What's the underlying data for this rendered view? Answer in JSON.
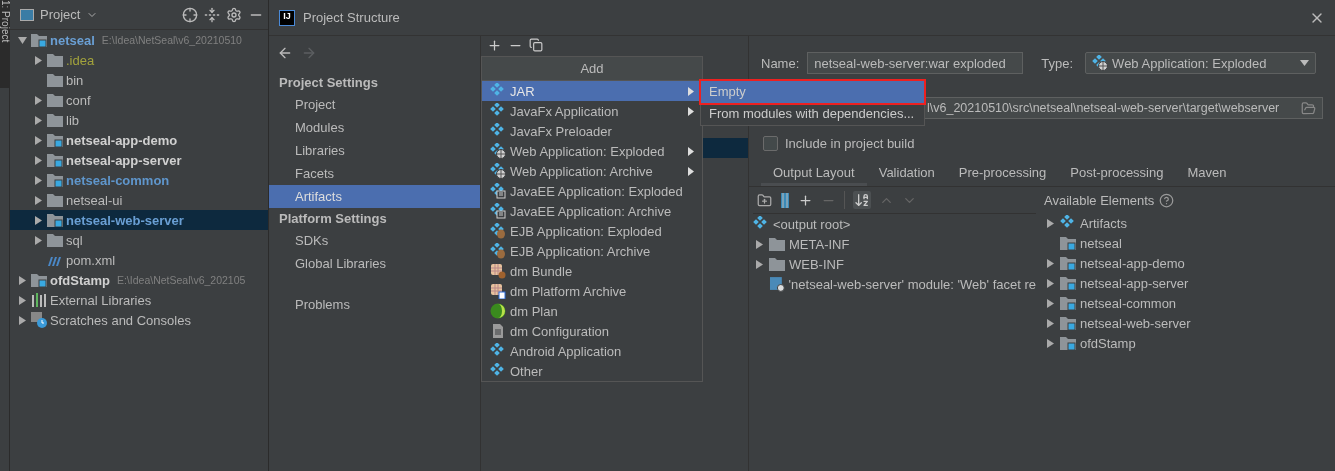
{
  "tool_strip": {
    "label": "1: Project"
  },
  "project_panel": {
    "title": "Project",
    "tree": [
      {
        "label": "netseal",
        "path": "E:\\Idea\\NetSeal\\v6_20210510",
        "kind": "module",
        "bold": true,
        "color": "#6a9fd4",
        "expandable": true,
        "expanded": true,
        "selected": false,
        "children": [
          {
            "label": ".idea",
            "kind": "folder",
            "bold": false,
            "color": "#a3a33c",
            "expandable": true,
            "expanded": false,
            "selected": false
          },
          {
            "label": "bin",
            "kind": "folder",
            "bold": false,
            "color": "#bbbbbb",
            "expandable": false,
            "expanded": false,
            "selected": false
          },
          {
            "label": "conf",
            "kind": "folder",
            "bold": false,
            "color": "#bbbbbb",
            "expandable": true,
            "expanded": false,
            "selected": false
          },
          {
            "label": "lib",
            "kind": "folder",
            "bold": false,
            "color": "#bbbbbb",
            "expandable": true,
            "expanded": false,
            "selected": false
          },
          {
            "label": "netseal-app-demo",
            "kind": "module",
            "bold": true,
            "color": "#d0d0d0",
            "expandable": true,
            "expanded": false,
            "selected": false
          },
          {
            "label": "netseal-app-server",
            "kind": "module",
            "bold": true,
            "color": "#d0d0d0",
            "expandable": true,
            "expanded": false,
            "selected": false
          },
          {
            "label": "netseal-common",
            "kind": "module",
            "bold": true,
            "color": "#5f96cc",
            "expandable": true,
            "expanded": false,
            "selected": false
          },
          {
            "label": "netseal-ui",
            "kind": "folder",
            "bold": false,
            "color": "#bbbbbb",
            "expandable": true,
            "expanded": false,
            "selected": false
          },
          {
            "label": "netseal-web-server",
            "kind": "module",
            "bold": true,
            "color": "#6a9fd4",
            "expandable": true,
            "expanded": false,
            "selected": true
          },
          {
            "label": "sql",
            "kind": "folder",
            "bold": false,
            "color": "#bbbbbb",
            "expandable": true,
            "expanded": false,
            "selected": false
          },
          {
            "label": "pom.xml",
            "kind": "maven",
            "bold": false,
            "color": "#bbbbbb",
            "expandable": false,
            "expanded": false,
            "selected": false
          }
        ]
      },
      {
        "label": "ofdStamp",
        "path": "E:\\Idea\\NetSeal\\v6_202105",
        "kind": "module",
        "bold": true,
        "color": "#d0d0d0",
        "expandable": true,
        "expanded": false,
        "selected": false
      },
      {
        "label": "External Libraries",
        "kind": "libraries",
        "bold": false,
        "color": "#bbbbbb",
        "expandable": true,
        "expanded": false,
        "selected": false
      },
      {
        "label": "Scratches and Consoles",
        "kind": "scratches",
        "bold": false,
        "color": "#bbbbbb",
        "expandable": true,
        "expanded": false,
        "selected": false
      }
    ]
  },
  "dialog": {
    "logo": "IJ",
    "title": "Project Structure",
    "nav": [
      {
        "heading": "Project Settings",
        "items": [
          {
            "label": "Project",
            "selected": false
          },
          {
            "label": "Modules",
            "selected": false
          },
          {
            "label": "Libraries",
            "selected": false
          },
          {
            "label": "Facets",
            "selected": false
          },
          {
            "label": "Artifacts",
            "selected": true
          }
        ]
      },
      {
        "heading": "Platform Settings",
        "items": [
          {
            "label": "SDKs",
            "selected": false
          },
          {
            "label": "Global Libraries",
            "selected": false
          }
        ]
      },
      {
        "items": [
          {
            "label": "Problems",
            "selected": false
          }
        ]
      }
    ],
    "artifacts": [
      {
        "selected": true
      }
    ],
    "add_menu": {
      "title": "Add",
      "items": [
        {
          "label": "JAR",
          "kind": "artifact",
          "submenu": true,
          "selected": true
        },
        {
          "label": "JavaFx Application",
          "kind": "artifact",
          "submenu": true,
          "selected": false
        },
        {
          "label": "JavaFx Preloader",
          "kind": "artifact",
          "submenu": false,
          "selected": false
        },
        {
          "label": "Web Application: Exploded",
          "kind": "web",
          "submenu": true,
          "selected": false
        },
        {
          "label": "Web Application: Archive",
          "kind": "web",
          "submenu": true,
          "selected": false
        },
        {
          "label": "JavaEE Application: Exploded",
          "kind": "javaee",
          "submenu": false,
          "selected": false
        },
        {
          "label": "JavaEE Application: Archive",
          "kind": "javaee",
          "submenu": false,
          "selected": false
        },
        {
          "label": "EJB Application: Exploded",
          "kind": "ejb",
          "submenu": false,
          "selected": false
        },
        {
          "label": "EJB Application: Archive",
          "kind": "ejb",
          "submenu": false,
          "selected": false
        },
        {
          "label": "dm Bundle",
          "kind": "bundle",
          "submenu": false,
          "selected": false
        },
        {
          "label": "dm Platform Archive",
          "kind": "platform",
          "submenu": false,
          "selected": false
        },
        {
          "label": "dm Plan",
          "kind": "plan",
          "submenu": false,
          "selected": false
        },
        {
          "label": "dm Configuration",
          "kind": "config",
          "submenu": false,
          "selected": false
        },
        {
          "label": "Android Application",
          "kind": "artifact",
          "submenu": false,
          "selected": false
        },
        {
          "label": "Other",
          "kind": "artifact",
          "submenu": false,
          "selected": false
        }
      ]
    },
    "jar_submenu": [
      {
        "label": "Empty",
        "selected": true,
        "highlighted": true
      },
      {
        "label": "From modules with dependencies...",
        "selected": false,
        "highlighted": false
      }
    ],
    "name_label": "Name:",
    "name_value": "netseal-web-server:war exploded",
    "type_label": "Type:",
    "type_value": "Web Application: Exploded",
    "output_directory": "l\\v6_20210510\\src\\netseal\\netseal-web-server\\target\\webserver",
    "include_in_build": {
      "label": "Include in project build",
      "checked": false
    },
    "tabs": [
      {
        "label": "Output Layout",
        "selected": true
      },
      {
        "label": "Validation",
        "selected": false
      },
      {
        "label": "Pre-processing",
        "selected": false
      },
      {
        "label": "Post-processing",
        "selected": false
      },
      {
        "label": "Maven",
        "selected": false
      }
    ],
    "layout_tree": [
      {
        "label": "<output root>",
        "kind": "artifact",
        "expandable": false
      },
      {
        "label": "META-INF",
        "kind": "folder",
        "expandable": true
      },
      {
        "label": "WEB-INF",
        "kind": "folder",
        "expandable": true
      },
      {
        "label": "'netseal-web-server' module: 'Web' facet re",
        "kind": "webmodule",
        "expandable": false
      }
    ],
    "available_title": "Available Elements",
    "available": [
      {
        "label": "Artifacts",
        "kind": "artifact",
        "expandable": true
      },
      {
        "label": "netseal",
        "kind": "module",
        "expandable": false
      },
      {
        "label": "netseal-app-demo",
        "kind": "module",
        "expandable": true
      },
      {
        "label": "netseal-app-server",
        "kind": "module",
        "expandable": true
      },
      {
        "label": "netseal-common",
        "kind": "module",
        "expandable": true
      },
      {
        "label": "netseal-web-server",
        "kind": "module",
        "expandable": true
      },
      {
        "label": "ofdStamp",
        "kind": "module",
        "expandable": true
      }
    ]
  }
}
